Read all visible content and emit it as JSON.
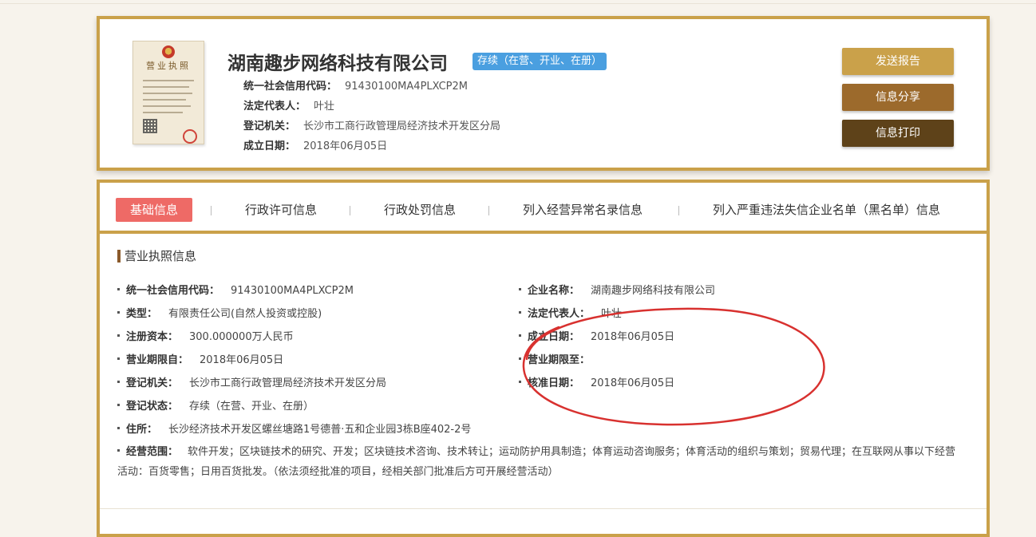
{
  "header": {
    "license_image": {
      "title": "营业执照"
    },
    "company_name": "湖南趣步网络科技有限公司",
    "status_badge": "存续（在营、开业、在册）",
    "rows": [
      {
        "label": "统一社会信用代码：",
        "value": "91430100MA4PLXCP2M"
      },
      {
        "label": "法定代表人：",
        "value": "叶壮"
      },
      {
        "label": "登记机关：",
        "value": "长沙市工商行政管理局经济技术开发区分局"
      },
      {
        "label": "成立日期：",
        "value": "2018年06月05日"
      }
    ],
    "buttons": {
      "send_report": "发送报告",
      "share": "信息分享",
      "print": "信息打印"
    }
  },
  "tabs": [
    {
      "label": "基础信息",
      "active": true
    },
    {
      "label": "行政许可信息",
      "active": false
    },
    {
      "label": "行政处罚信息",
      "active": false
    },
    {
      "label": "列入经营异常名录信息",
      "active": false
    },
    {
      "label": "列入严重违法失信企业名单（黑名单）信息",
      "active": false
    }
  ],
  "section": {
    "title": "营业执照信息",
    "left_fields": [
      {
        "label": "统一社会信用代码：",
        "value": "91430100MA4PLXCP2M"
      },
      {
        "label": "类型：",
        "value": "有限责任公司(自然人投资或控股)"
      },
      {
        "label": "注册资本：",
        "value": "300.000000万人民币"
      },
      {
        "label": "营业期限自：",
        "value": "2018年06月05日"
      },
      {
        "label": "登记机关：",
        "value": "长沙市工商行政管理局经济技术开发区分局"
      },
      {
        "label": "登记状态：",
        "value": "存续（在营、开业、在册）"
      },
      {
        "label": "住所：",
        "value": "长沙经济技术开发区螺丝塘路1号德普·五和企业园3栋B座402-2号"
      }
    ],
    "right_fields": [
      {
        "label": "企业名称：",
        "value": "湖南趣步网络科技有限公司"
      },
      {
        "label": "法定代表人：",
        "value": "叶壮"
      },
      {
        "label": "成立日期：",
        "value": "2018年06月05日"
      },
      {
        "label": "营业期限至：",
        "value": ""
      },
      {
        "label": "核准日期：",
        "value": "2018年06月05日"
      }
    ],
    "scope": {
      "label": "经营范围：",
      "value": "软件开发；区块链技术的研究、开发；区块链技术咨询、技术转让；运动防护用具制造；体育运动咨询服务；体育活动的组织与策划；贸易代理；在互联网从事以下经营活动：百货零售；日用百货批发。（依法须经批准的项目，经相关部门批准后方可开展经营活动）"
    }
  },
  "colors": {
    "border_gold": "#caa14a",
    "badge_blue": "#4a9fe0",
    "btn_send": "#caa14a",
    "btn_share": "#9c6a2c",
    "btn_print": "#5e4219",
    "tab_active": "#ee6a66",
    "annotation_red": "#d8312f"
  }
}
